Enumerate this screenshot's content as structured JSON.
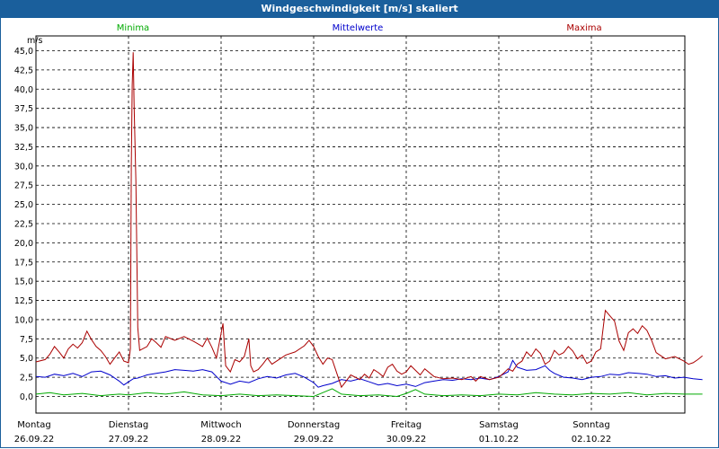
{
  "window": {
    "title": "Windgeschwindigkeit [m/s] skaliert"
  },
  "colors": {
    "titlebar": "#1a5f9c",
    "min": "#00aa00",
    "mean": "#0000cc",
    "max": "#aa0000"
  },
  "chart_data": {
    "type": "line",
    "ylabel": "m/s",
    "ylim": [
      0,
      45
    ],
    "yticks": [
      "45,0",
      "42,5",
      "40,0",
      "37,5",
      "35,0",
      "32,5",
      "30,0",
      "27,5",
      "25,0",
      "22,5",
      "20,0",
      "17,5",
      "15,0",
      "12,5",
      "10,0",
      "7,5",
      "5,0",
      "2,5",
      "0,0"
    ],
    "x_labels": [
      {
        "day": "Montag",
        "date": "26.09.22"
      },
      {
        "day": "Dienstag",
        "date": "27.09.22"
      },
      {
        "day": "Mittwoch",
        "date": "28.09.22"
      },
      {
        "day": "Donnerstag",
        "date": "29.09.22"
      },
      {
        "day": "Freitag",
        "date": "30.09.22"
      },
      {
        "day": "Samstag",
        "date": "01.10.22"
      },
      {
        "day": "Sonntag",
        "date": "02.10.22"
      }
    ],
    "x_unit": "days since 26.09.22",
    "series": [
      {
        "name": "Minima",
        "color": "#00aa00",
        "points": [
          [
            0,
            0.3
          ],
          [
            0.15,
            0.5
          ],
          [
            0.3,
            0.2
          ],
          [
            0.5,
            0.4
          ],
          [
            0.7,
            0.1
          ],
          [
            0.9,
            0.3
          ],
          [
            1.0,
            0.2
          ],
          [
            1.2,
            0.5
          ],
          [
            1.4,
            0.3
          ],
          [
            1.6,
            0.6
          ],
          [
            1.8,
            0.2
          ],
          [
            2.0,
            0.1
          ],
          [
            2.2,
            0.3
          ],
          [
            2.4,
            0.1
          ],
          [
            2.6,
            0.2
          ],
          [
            2.8,
            0.1
          ],
          [
            3.0,
            0.0
          ],
          [
            3.1,
            0.5
          ],
          [
            3.2,
            1.0
          ],
          [
            3.3,
            0.3
          ],
          [
            3.5,
            0.1
          ],
          [
            3.7,
            0.2
          ],
          [
            3.9,
            0.0
          ],
          [
            4.0,
            0.4
          ],
          [
            4.1,
            0.9
          ],
          [
            4.2,
            0.3
          ],
          [
            4.4,
            0.1
          ],
          [
            4.6,
            0.2
          ],
          [
            4.8,
            0.1
          ],
          [
            5.0,
            0.3
          ],
          [
            5.2,
            0.2
          ],
          [
            5.4,
            0.5
          ],
          [
            5.6,
            0.3
          ],
          [
            5.8,
            0.2
          ],
          [
            6.0,
            0.4
          ],
          [
            6.2,
            0.3
          ],
          [
            6.4,
            0.5
          ],
          [
            6.6,
            0.2
          ],
          [
            6.8,
            0.4
          ],
          [
            7.0,
            0.3
          ],
          [
            7.2,
            0.3
          ]
        ]
      },
      {
        "name": "Mittelwerte",
        "color": "#0000cc",
        "points": [
          [
            0,
            2.6
          ],
          [
            0.1,
            2.5
          ],
          [
            0.2,
            2.9
          ],
          [
            0.3,
            2.7
          ],
          [
            0.4,
            3.0
          ],
          [
            0.5,
            2.6
          ],
          [
            0.6,
            3.2
          ],
          [
            0.7,
            3.3
          ],
          [
            0.8,
            2.8
          ],
          [
            0.9,
            2.0
          ],
          [
            0.95,
            1.5
          ],
          [
            1.0,
            1.9
          ],
          [
            1.05,
            2.3
          ],
          [
            1.1,
            2.4
          ],
          [
            1.15,
            2.6
          ],
          [
            1.2,
            2.8
          ],
          [
            1.3,
            3.0
          ],
          [
            1.4,
            3.2
          ],
          [
            1.5,
            3.5
          ],
          [
            1.6,
            3.4
          ],
          [
            1.7,
            3.3
          ],
          [
            1.8,
            3.5
          ],
          [
            1.9,
            3.2
          ],
          [
            1.95,
            2.6
          ],
          [
            2.0,
            2.0
          ],
          [
            2.1,
            1.6
          ],
          [
            2.2,
            2.0
          ],
          [
            2.3,
            1.8
          ],
          [
            2.4,
            2.3
          ],
          [
            2.5,
            2.6
          ],
          [
            2.6,
            2.4
          ],
          [
            2.7,
            2.8
          ],
          [
            2.8,
            3.0
          ],
          [
            2.9,
            2.5
          ],
          [
            3.0,
            1.8
          ],
          [
            3.05,
            1.2
          ],
          [
            3.1,
            1.4
          ],
          [
            3.2,
            1.7
          ],
          [
            3.3,
            2.2
          ],
          [
            3.4,
            2.0
          ],
          [
            3.5,
            2.3
          ],
          [
            3.6,
            1.9
          ],
          [
            3.7,
            1.5
          ],
          [
            3.8,
            1.7
          ],
          [
            3.9,
            1.4
          ],
          [
            4.0,
            1.6
          ],
          [
            4.1,
            1.3
          ],
          [
            4.2,
            1.8
          ],
          [
            4.3,
            2.0
          ],
          [
            4.4,
            2.2
          ],
          [
            4.5,
            2.1
          ],
          [
            4.6,
            2.3
          ],
          [
            4.7,
            2.2
          ],
          [
            4.8,
            2.4
          ],
          [
            4.9,
            2.2
          ],
          [
            5.0,
            2.6
          ],
          [
            5.1,
            3.2
          ],
          [
            5.15,
            4.7
          ],
          [
            5.2,
            3.8
          ],
          [
            5.3,
            3.4
          ],
          [
            5.4,
            3.5
          ],
          [
            5.5,
            4.0
          ],
          [
            5.55,
            3.4
          ],
          [
            5.6,
            3.0
          ],
          [
            5.7,
            2.5
          ],
          [
            5.8,
            2.4
          ],
          [
            5.9,
            2.2
          ],
          [
            6.0,
            2.5
          ],
          [
            6.1,
            2.6
          ],
          [
            6.2,
            2.9
          ],
          [
            6.3,
            2.8
          ],
          [
            6.4,
            3.1
          ],
          [
            6.5,
            3.0
          ],
          [
            6.6,
            2.9
          ],
          [
            6.7,
            2.6
          ],
          [
            6.8,
            2.7
          ],
          [
            6.9,
            2.4
          ],
          [
            7.0,
            2.5
          ],
          [
            7.1,
            2.3
          ],
          [
            7.2,
            2.2
          ]
        ]
      },
      {
        "name": "Maxima",
        "color": "#aa0000",
        "points": [
          [
            0,
            4.5
          ],
          [
            0.1,
            4.8
          ],
          [
            0.15,
            5.5
          ],
          [
            0.2,
            6.5
          ],
          [
            0.25,
            5.8
          ],
          [
            0.3,
            5.0
          ],
          [
            0.35,
            6.2
          ],
          [
            0.4,
            6.8
          ],
          [
            0.45,
            6.3
          ],
          [
            0.5,
            7.0
          ],
          [
            0.55,
            8.5
          ],
          [
            0.6,
            7.4
          ],
          [
            0.65,
            6.5
          ],
          [
            0.7,
            6.0
          ],
          [
            0.75,
            5.2
          ],
          [
            0.8,
            4.2
          ],
          [
            0.85,
            5.0
          ],
          [
            0.9,
            5.8
          ],
          [
            0.95,
            4.6
          ],
          [
            1.0,
            4.4
          ],
          [
            1.02,
            6.2
          ],
          [
            1.03,
            30.0
          ],
          [
            1.04,
            40.5
          ],
          [
            1.05,
            44.8
          ],
          [
            1.06,
            38.0
          ],
          [
            1.08,
            28.0
          ],
          [
            1.1,
            9.0
          ],
          [
            1.12,
            6.0
          ],
          [
            1.2,
            6.5
          ],
          [
            1.25,
            7.5
          ],
          [
            1.3,
            7.0
          ],
          [
            1.35,
            6.4
          ],
          [
            1.4,
            7.8
          ],
          [
            1.5,
            7.3
          ],
          [
            1.6,
            7.8
          ],
          [
            1.7,
            7.2
          ],
          [
            1.8,
            6.5
          ],
          [
            1.85,
            7.6
          ],
          [
            1.9,
            6.4
          ],
          [
            1.95,
            5.0
          ],
          [
            2.0,
            8.2
          ],
          [
            2.02,
            9.5
          ],
          [
            2.05,
            4.0
          ],
          [
            2.1,
            3.2
          ],
          [
            2.15,
            4.8
          ],
          [
            2.2,
            4.5
          ],
          [
            2.25,
            5.2
          ],
          [
            2.3,
            7.5
          ],
          [
            2.32,
            4.0
          ],
          [
            2.35,
            3.2
          ],
          [
            2.4,
            3.5
          ],
          [
            2.45,
            4.2
          ],
          [
            2.5,
            5.0
          ],
          [
            2.55,
            4.2
          ],
          [
            2.6,
            4.6
          ],
          [
            2.7,
            5.4
          ],
          [
            2.8,
            5.8
          ],
          [
            2.9,
            6.6
          ],
          [
            2.95,
            7.3
          ],
          [
            3.0,
            6.5
          ],
          [
            3.05,
            5.2
          ],
          [
            3.1,
            4.2
          ],
          [
            3.15,
            5.0
          ],
          [
            3.2,
            4.8
          ],
          [
            3.25,
            3.0
          ],
          [
            3.3,
            1.2
          ],
          [
            3.35,
            2.0
          ],
          [
            3.4,
            2.8
          ],
          [
            3.5,
            2.2
          ],
          [
            3.55,
            2.9
          ],
          [
            3.6,
            2.4
          ],
          [
            3.65,
            3.5
          ],
          [
            3.7,
            3.1
          ],
          [
            3.75,
            2.6
          ],
          [
            3.8,
            3.8
          ],
          [
            3.85,
            4.2
          ],
          [
            3.9,
            3.3
          ],
          [
            3.95,
            2.9
          ],
          [
            4.0,
            3.2
          ],
          [
            4.05,
            4.0
          ],
          [
            4.1,
            3.4
          ],
          [
            4.15,
            2.8
          ],
          [
            4.2,
            3.6
          ],
          [
            4.3,
            2.6
          ],
          [
            4.4,
            2.3
          ],
          [
            4.5,
            2.4
          ],
          [
            4.6,
            2.2
          ],
          [
            4.7,
            2.6
          ],
          [
            4.75,
            2.0
          ],
          [
            4.8,
            2.6
          ],
          [
            4.9,
            2.2
          ],
          [
            5.0,
            2.5
          ],
          [
            5.05,
            3.0
          ],
          [
            5.1,
            3.6
          ],
          [
            5.15,
            3.3
          ],
          [
            5.2,
            4.2
          ],
          [
            5.25,
            4.6
          ],
          [
            5.3,
            5.8
          ],
          [
            5.35,
            5.2
          ],
          [
            5.4,
            6.2
          ],
          [
            5.45,
            5.6
          ],
          [
            5.5,
            4.2
          ],
          [
            5.55,
            4.6
          ],
          [
            5.6,
            6.0
          ],
          [
            5.65,
            5.4
          ],
          [
            5.7,
            5.7
          ],
          [
            5.75,
            6.5
          ],
          [
            5.8,
            5.9
          ],
          [
            5.85,
            4.9
          ],
          [
            5.9,
            5.4
          ],
          [
            5.95,
            4.3
          ],
          [
            6.0,
            4.6
          ],
          [
            6.05,
            5.8
          ],
          [
            6.1,
            6.2
          ],
          [
            6.15,
            11.2
          ],
          [
            6.2,
            10.5
          ],
          [
            6.25,
            9.8
          ],
          [
            6.3,
            7.2
          ],
          [
            6.35,
            6.0
          ],
          [
            6.4,
            8.3
          ],
          [
            6.45,
            8.8
          ],
          [
            6.5,
            8.2
          ],
          [
            6.55,
            9.2
          ],
          [
            6.6,
            8.6
          ],
          [
            6.65,
            7.3
          ],
          [
            6.7,
            5.7
          ],
          [
            6.8,
            4.9
          ],
          [
            6.9,
            5.2
          ],
          [
            7.0,
            4.6
          ],
          [
            7.05,
            4.2
          ],
          [
            7.1,
            4.4
          ],
          [
            7.15,
            4.8
          ],
          [
            7.2,
            5.3
          ]
        ]
      }
    ]
  }
}
